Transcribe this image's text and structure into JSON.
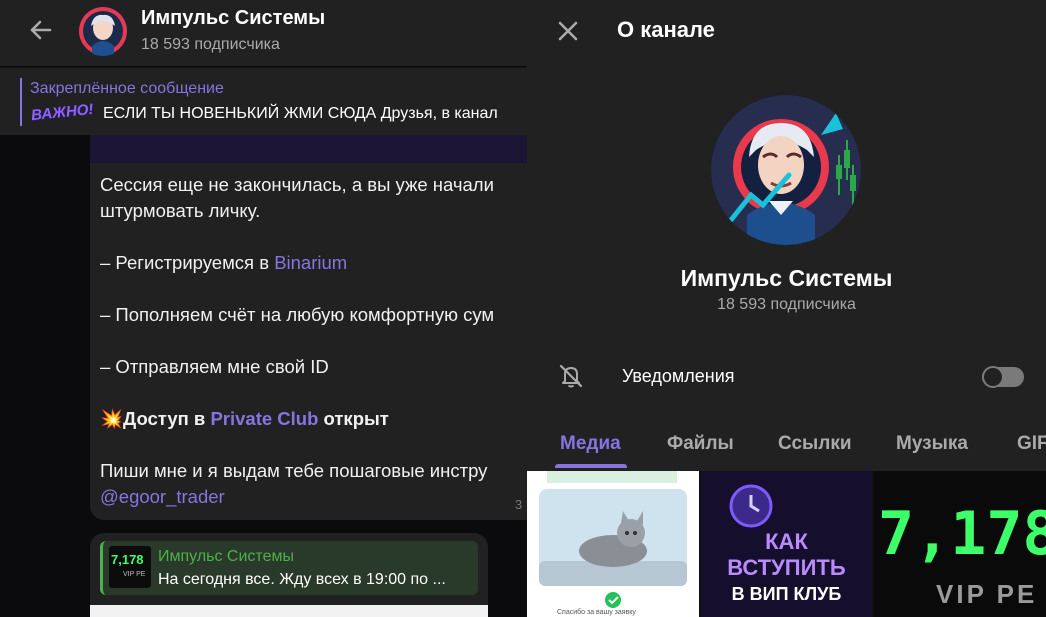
{
  "chat": {
    "header": {
      "title": "Импульс Системы",
      "subtitle": "18 593 подписчика"
    },
    "pinned": {
      "title": "Закреплённое сообщение",
      "badge": "ВАЖНО!",
      "text": "ЕСЛИ ТЫ НОВЕНЬКИЙ ЖМИ СЮДА Друзья, в канал"
    },
    "message": {
      "line1": "Сессия еще не закончилась, а вы уже начали",
      "line2": "штурмовать личку.",
      "step1_prefix": "– Регистрируемся в ",
      "step1_link": "Binarium",
      "step2": "– Пополняем счёт на любую комфортную сум",
      "step3": "– Отправляем мне свой ID",
      "access_emoji": "💥",
      "access_prefix": "Доступ в ",
      "access_link": "Private Club",
      "access_suffix": " открыт",
      "cta": "Пиши мне и я выдам тебе пошаговые инстру",
      "contact": "@egoor_trader",
      "time": "3"
    },
    "forwarded": {
      "thumb_number": "7,178",
      "thumb_sub": "VIP PE",
      "name": "Импульс Системы",
      "text": "На сегодня все. Жду всех в 19:00 по ..."
    }
  },
  "panel": {
    "title": "О канале",
    "channel_name": "Импульс Системы",
    "subscribers": "18 593 подписчика",
    "notifications_label": "Уведомления",
    "notifications_on": false,
    "tabs": [
      "Медиа",
      "Файлы",
      "Ссылки",
      "Музыка",
      "GIF"
    ],
    "active_tab": 0,
    "media": {
      "tile1_caption": "Спасибо за вашу заявку",
      "tile2_text": [
        "КАК",
        "ВСТУПИТЬ",
        "В ВИП КЛУБ"
      ],
      "tile3_number": "7,178",
      "tile3_sub": "VIP PE"
    }
  },
  "colors": {
    "accent": "#8774e1",
    "forward_accent": "#4fae4e",
    "panel_bg": "#212121"
  }
}
